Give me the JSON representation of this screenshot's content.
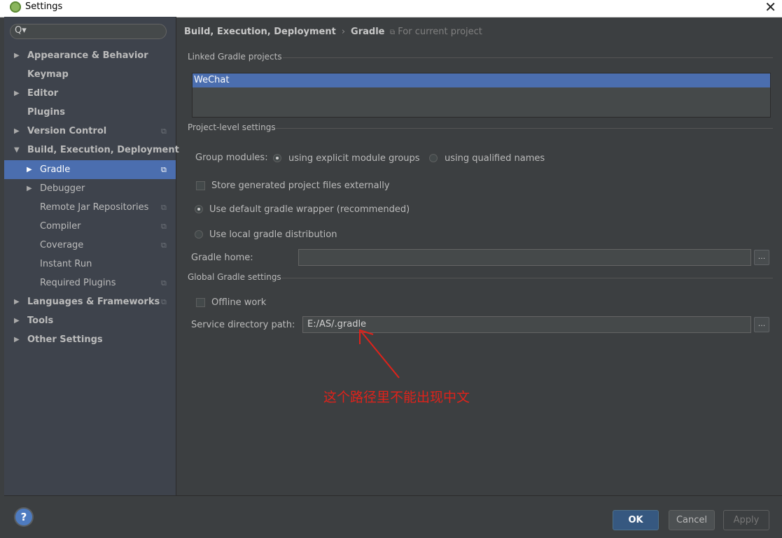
{
  "window": {
    "title": "Settings",
    "close_glyph": "✕"
  },
  "search": {
    "icon_glyph": "Q▾",
    "value": ""
  },
  "sidebar": {
    "items": [
      {
        "label": "Appearance & Behavior",
        "arrow": "▶",
        "bold": true
      },
      {
        "label": "Keymap",
        "bold": true
      },
      {
        "label": "Editor",
        "arrow": "▶",
        "bold": true
      },
      {
        "label": "Plugins",
        "bold": true
      },
      {
        "label": "Version Control",
        "arrow": "▶",
        "bold": true,
        "project_icon": true
      },
      {
        "label": "Build, Execution, Deployment",
        "arrow": "▼",
        "bold": true
      },
      {
        "label": "Gradle",
        "arrow": "▶",
        "child": true,
        "selected": true,
        "project_icon": true
      },
      {
        "label": "Debugger",
        "arrow": "▶",
        "child": true
      },
      {
        "label": "Remote Jar Repositories",
        "child": true,
        "project_icon": true
      },
      {
        "label": "Compiler",
        "child": true,
        "project_icon": true
      },
      {
        "label": "Coverage",
        "child": true,
        "project_icon": true
      },
      {
        "label": "Instant Run",
        "child": true
      },
      {
        "label": "Required Plugins",
        "child": true,
        "project_icon": true
      },
      {
        "label": "Languages & Frameworks",
        "arrow": "▶",
        "bold": true,
        "project_icon": true
      },
      {
        "label": "Tools",
        "arrow": "▶",
        "bold": true
      },
      {
        "label": "Other Settings",
        "arrow": "▶",
        "bold": true
      }
    ],
    "project_icon_glyph": "⧉"
  },
  "breadcrumb": {
    "part1": "Build, Execution, Deployment",
    "separator": "›",
    "part2": "Gradle",
    "for_project": "For current project",
    "for_project_icon": "⧉"
  },
  "linked_projects": {
    "heading": "Linked Gradle projects",
    "items": [
      "WeChat"
    ]
  },
  "project_settings": {
    "heading": "Project-level settings",
    "group_modules_label": "Group modules:",
    "option_explicit": "using explicit module groups",
    "option_qualified": "using qualified names",
    "store_externally": "Store generated project files externally",
    "use_default_wrapper": "Use default gradle wrapper (recommended)",
    "use_local_distribution": "Use local gradle distribution",
    "gradle_home_label": "Gradle home:",
    "gradle_home_value": "",
    "browse_glyph": "..."
  },
  "global_settings": {
    "heading": "Global Gradle settings",
    "offline_work": "Offline work",
    "service_dir_label": "Service directory path:",
    "service_dir_value": "E:/AS/.gradle"
  },
  "annotation": {
    "text": "这个路径里不能出现中文",
    "color": "#e0221a"
  },
  "footer": {
    "help_glyph": "?",
    "ok_label": "OK",
    "cancel_label": "Cancel",
    "apply_label": "Apply"
  },
  "colors": {
    "background": "#3c3f41",
    "sidebar": "#3e434c",
    "selection": "#4b6eaf",
    "primary_button": "#365880"
  }
}
